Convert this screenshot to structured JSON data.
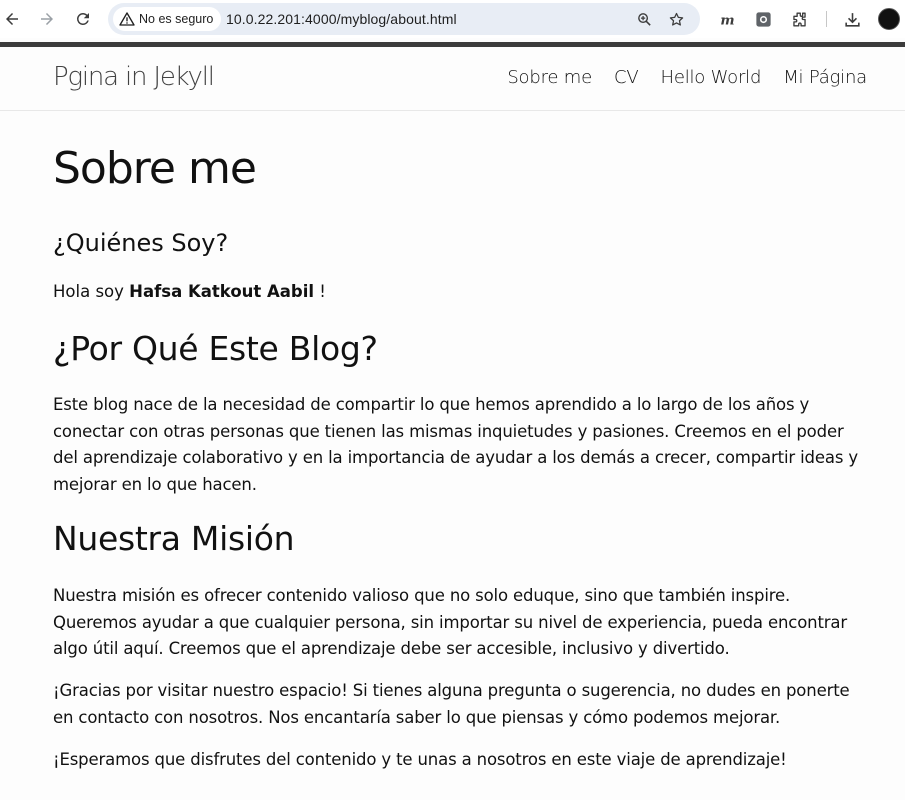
{
  "browser": {
    "security_label": "No es seguro",
    "url": "10.0.22.201:4000/myblog/about.html",
    "icons": [
      "back-icon",
      "forward-icon",
      "reload-icon",
      "warning-icon",
      "zoom-icon",
      "star-icon",
      "extension-m-icon",
      "extension-camera-icon",
      "puzzle-icon",
      "download-icon",
      "avatar"
    ]
  },
  "site": {
    "title": "Pgina in Jekyll",
    "nav": [
      {
        "label": "Sobre me"
      },
      {
        "label": "CV"
      },
      {
        "label": "Hello World"
      },
      {
        "label": "Mi Página"
      }
    ]
  },
  "page": {
    "title": "Sobre me",
    "who_heading": "¿Quiénes Soy?",
    "intro_prefix": "Hola soy ",
    "intro_name": "Hafsa Katkout Aabil",
    "intro_suffix": " !",
    "why_heading": "¿Por Qué Este Blog?",
    "why_text": "Este blog nace de la necesidad de compartir lo que hemos aprendido a lo largo de los años y conectar con otras personas que tienen las mismas inquietudes y pasiones. Creemos en el poder del aprendizaje colaborativo y en la importancia de ayudar a los demás a crecer, compartir ideas y mejorar en lo que hacen.",
    "mission_heading": "Nuestra Misión",
    "mission_text": "Nuestra misión es ofrecer contenido valioso que no solo eduque, sino que también inspire. Queremos ayudar a que cualquier persona, sin importar su nivel de experiencia, pueda encontrar algo útil aquí. Creemos que el aprendizaje debe ser accesible, inclusivo y divertido.",
    "thanks_text": "¡Gracias por visitar nuestro espacio! Si tienes alguna pregunta o sugerencia, no dudes en ponerte en contacto con nosotros. Nos encantaría saber lo que piensas y cómo podemos mejorar.",
    "closing_text": "¡Esperamos que disfrutes del contenido y te unas a nosotros en este viaje de aprendizaje!"
  }
}
